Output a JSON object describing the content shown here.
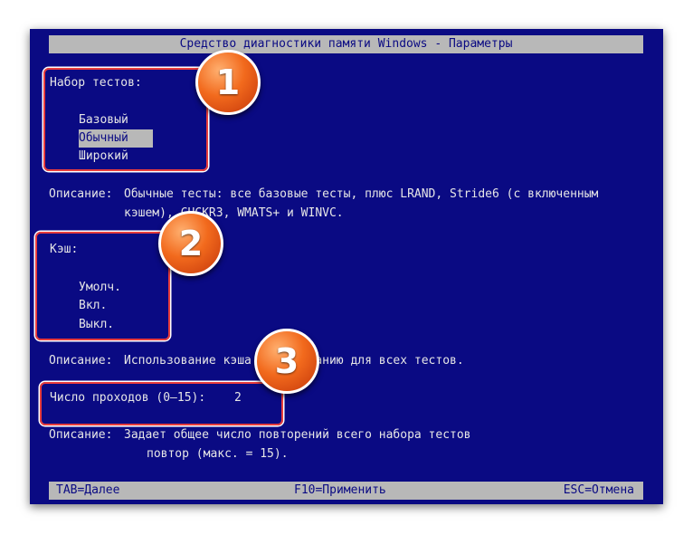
{
  "window": {
    "title": "Средство диагностики памяти Windows - Параметры"
  },
  "test_mix": {
    "label": "Набор тестов:",
    "options": [
      "Базовый",
      "Обычный",
      "Широкий"
    ],
    "selected": "Обычный",
    "description_label": "Описание:",
    "description_line1": "Обычные тесты: все базовые тесты, плюс LRAND, Stride6 (с включенным",
    "description_line2": "кэшем), CHCKR3, WMATS+ и WINVC."
  },
  "cache": {
    "label": "Кэш:",
    "options": [
      "Умолч.",
      "Вкл.",
      "Выкл."
    ],
    "description_label": "Описание:",
    "description": "Использование кэша по умолчанию для всех тестов."
  },
  "pass_count": {
    "label": "Число проходов (0–15):",
    "value": "2",
    "description_label": "Описание:",
    "description_line1": "Задает общее число повторений всего набора тестов",
    "description_line2": "повтор (макс. = 15)."
  },
  "status_bar": {
    "tab": "TAB=Далее",
    "f10": "F10=Применить",
    "esc": "ESC=Отмена"
  },
  "callouts": [
    "1",
    "2",
    "3"
  ],
  "colors": {
    "screen_bg": "#0a0a83",
    "bar_bg": "#b8b8b8",
    "text": "#e6e6e6",
    "highlight_border": "#e83c3c",
    "badge": "#f26a1d"
  }
}
